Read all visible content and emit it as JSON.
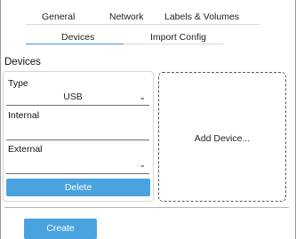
{
  "tabs_primary": {
    "general": "General",
    "network": "Network",
    "labels_volumes": "Labels & Volumes"
  },
  "tabs_secondary": {
    "devices": "Devices",
    "import_config": "Import Config",
    "active": "Devices"
  },
  "devices_section": {
    "title": "Devices",
    "card": {
      "type_label": "Type",
      "type_value": "USB",
      "internal_label": "Internal",
      "internal_value": "",
      "external_label": "External",
      "external_value": "",
      "delete_label": "Delete"
    },
    "add_device_label": "Add Device..."
  },
  "footer": {
    "create_label": "Create"
  },
  "colors": {
    "accent": "#4aa3df",
    "tab_underline": "#4a90d9"
  },
  "icons": {
    "select_chevron": "chevron-down-icon"
  }
}
